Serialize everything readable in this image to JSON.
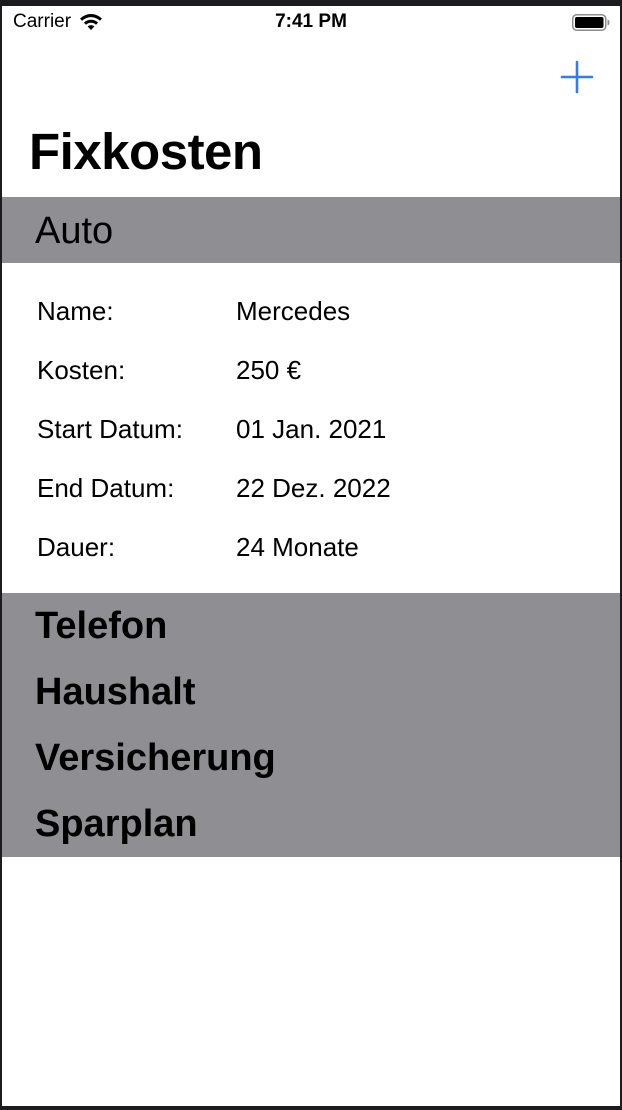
{
  "status_bar": {
    "carrier": "Carrier",
    "time": "7:41 PM",
    "wifi_icon": "wifi-icon",
    "battery_icon": "battery-icon"
  },
  "nav": {
    "add_icon": "plus-icon",
    "accent_color": "#2f7cf6",
    "title": "Fixkosten"
  },
  "sections": [
    {
      "label": "Auto",
      "expanded": true,
      "details": [
        {
          "key": "Name:",
          "value": "Mercedes"
        },
        {
          "key": "Kosten:",
          "value": "250 €"
        },
        {
          "key": "Start Datum:",
          "value": "01 Jan. 2021"
        },
        {
          "key": "End Datum:",
          "value": "22 Dez. 2022"
        },
        {
          "key": "Dauer:",
          "value": "24 Monate"
        }
      ]
    },
    {
      "label": "Telefon",
      "expanded": false
    },
    {
      "label": "Haushalt",
      "expanded": false
    },
    {
      "label": "Versicherung",
      "expanded": false
    },
    {
      "label": "Sparplan",
      "expanded": false
    }
  ],
  "colors": {
    "section_header_bg": "#8e8e93",
    "background": "#ffffff"
  }
}
